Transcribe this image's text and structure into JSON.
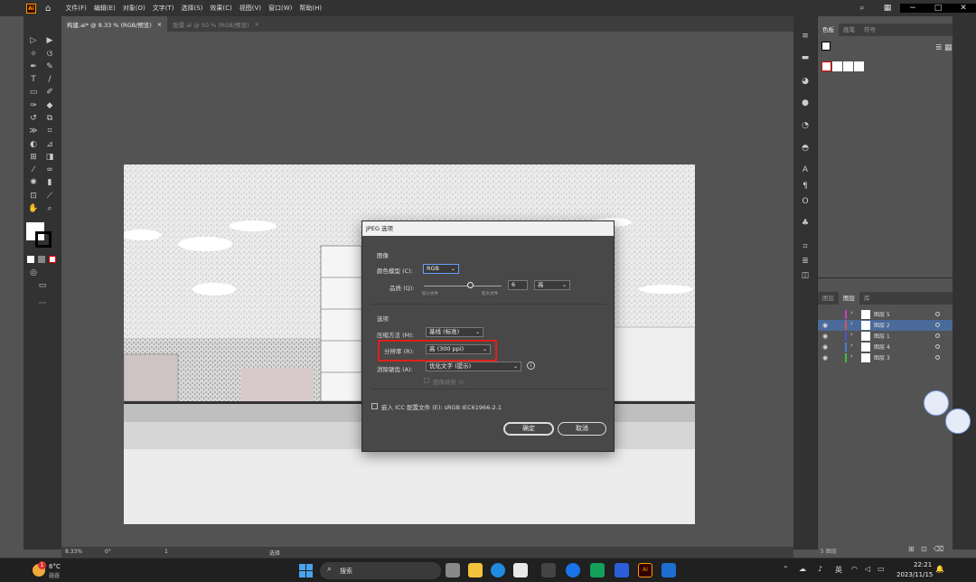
{
  "menubar": {
    "app_logo": "Ai",
    "items": [
      "文件(F)",
      "编辑(E)",
      "对象(O)",
      "文字(T)",
      "选择(S)",
      "效果(C)",
      "视图(V)",
      "窗口(W)",
      "帮助(H)"
    ],
    "window_controls": [
      "−",
      "□",
      "✕"
    ]
  },
  "tabs": [
    {
      "label": "构建.ai* @ 8.33 % (RGB/预览)",
      "close": "×"
    },
    {
      "label": "配景.ai @ 50 % (RGB/预览)",
      "close": "×"
    }
  ],
  "dialog": {
    "title": "JPEG 选项",
    "image_section": "图像",
    "color_model_label": "颜色模型 (C):",
    "color_model_value": "RGB",
    "quality_label": "品质 (Q):",
    "quality_value": "6",
    "quality_level": "高",
    "quality_min_label": "较小文件",
    "quality_max_label": "较大文件",
    "quality_slider_fraction": 0.6,
    "options_section": "选项",
    "compression_label": "压缩方法 (M):",
    "compression_value": "基线 (标准)",
    "resolution_label": "分辨率 (R):",
    "resolution_value": "高 (300 ppi)",
    "antialias_label": "消除锯齿 (A):",
    "antialias_value": "优化文字 (提示)",
    "imagemap_label": "图像映射 (I)",
    "icc_label": "嵌入 ICC 配置文件 (E): sRGB IEC61966-2.1",
    "ok_label": "确定",
    "cancel_label": "取消",
    "highlight_color": "#e0201a"
  },
  "right_panel": {
    "top_tabs": [
      "色板",
      "画笔",
      "符号"
    ],
    "layer_tabs": [
      "图层",
      "图层",
      "库"
    ],
    "layers": [
      {
        "name": "图层 5",
        "color": "#c040c0",
        "visible": false,
        "selected": false
      },
      {
        "name": "图层 2",
        "color": "#e05050",
        "visible": true,
        "selected": true
      },
      {
        "name": "图层 1",
        "color": "#5050e0",
        "visible": true,
        "selected": false
      },
      {
        "name": "图层 4",
        "color": "#4080e0",
        "visible": true,
        "selected": false
      },
      {
        "name": "图层 3",
        "color": "#40c040",
        "visible": true,
        "selected": false
      }
    ],
    "layers_count": "5 图层"
  },
  "statusbar": {
    "zoom": "8.33%",
    "rotation": "0°",
    "page": "1",
    "mode": "选择"
  },
  "taskbar": {
    "weather_temp": "6°C",
    "weather_desc": "霾霾",
    "search_label": "搜索",
    "lang": "英",
    "time": "22:21",
    "date": "2023/11/15",
    "badge_count": "1"
  }
}
